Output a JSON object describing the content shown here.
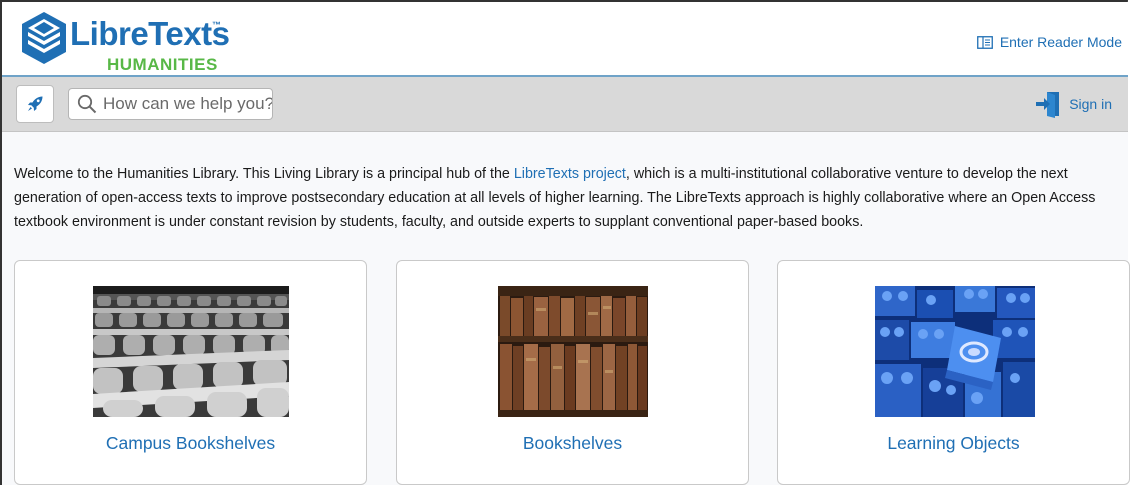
{
  "header": {
    "logo_text": "LibreTexts",
    "logo_tm": "™",
    "logo_subtitle": "HUMANITIES",
    "reader_mode_label": "Enter Reader Mode",
    "brand_color": "#1f6fb4",
    "accent_green": "#58b847"
  },
  "toolbar": {
    "search_placeholder": "How can we help you?",
    "signin_label": "Sign in"
  },
  "intro": {
    "text_before": "Welcome to the Humanities Library. This Living Library is a principal hub of the ",
    "link_text": "LibreTexts project",
    "text_after": ", which is a multi-institutional collaborative venture to develop the next generation of open-access texts to improve postsecondary education at all levels of higher learning. The LibreTexts approach is highly collaborative where an Open Access textbook environment is under constant revision by students, faculty, and outside experts to supplant conventional paper-based books."
  },
  "cards": [
    {
      "label": "Campus Bookshelves",
      "image": "lecture-hall-seats-image"
    },
    {
      "label": "Bookshelves",
      "image": "antique-books-image"
    },
    {
      "label": "Learning Objects",
      "image": "blue-lego-bricks-image"
    }
  ]
}
